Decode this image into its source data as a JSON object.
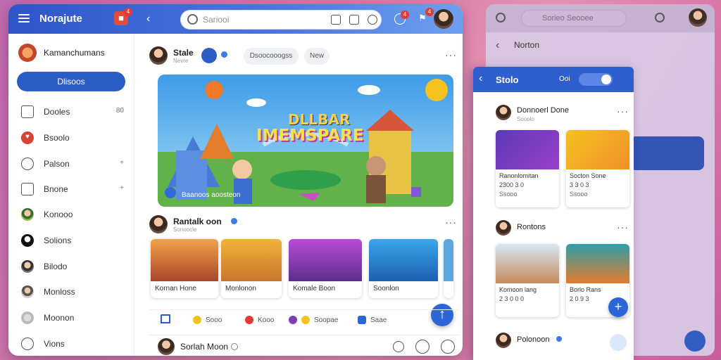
{
  "app": {
    "name": "Norajute",
    "notif_count": "4"
  },
  "search": {
    "placeholder": "Sariooi"
  },
  "header": {
    "notif_a": "4",
    "notif_b": "4"
  },
  "sidebar": {
    "profile_name": "Kamanchumans",
    "primary_button": "Dlisoos",
    "items": [
      {
        "label": "Dooles",
        "icon": "calendar-icon",
        "right": "80"
      },
      {
        "label": "Bsoolo",
        "icon": "heart-icon",
        "right": ""
      },
      {
        "label": "Palson",
        "icon": "chat-icon",
        "right": "+"
      },
      {
        "label": "Bnone",
        "icon": "file-icon",
        "right": "+"
      },
      {
        "label": "Konooo",
        "icon": "avatar",
        "right": ""
      },
      {
        "label": "Solions",
        "icon": "avatar",
        "right": ""
      },
      {
        "label": "Bilodo",
        "icon": "avatar",
        "right": ""
      },
      {
        "label": "Monloss",
        "icon": "avatar",
        "right": ""
      },
      {
        "label": "Moonon",
        "icon": "avatar",
        "right": ""
      },
      {
        "label": "Vions",
        "icon": "shield-icon",
        "right": ""
      }
    ]
  },
  "feed": {
    "post1": {
      "author": "Stale",
      "sub": "Nevre",
      "chip1": "Dsoocooogss",
      "chip2": "New"
    },
    "hero": {
      "title_top": "DLLBAR",
      "title_main": "IMEMSPARE",
      "caption": "Baanoos aoosteon"
    },
    "post2": {
      "author": "Rantalk oon",
      "sub": "Sonoocle",
      "thumbs": [
        "Kornan Hone",
        "Monlonon",
        "Komale Boon",
        "Soonlon"
      ]
    },
    "reactions": [
      "Sooo",
      "Kooo",
      "Soopae",
      "Saae"
    ],
    "post3": {
      "author": "Sorlah Moon"
    }
  },
  "phone": {
    "title": "Stolo",
    "toggle_label": "Ooi",
    "post1": {
      "author": "Donnoerl Done",
      "sub": "Sooolo"
    },
    "cards_row1": [
      {
        "title": "Ranonlomitan",
        "line2": "2300 3 0",
        "line3": "Ssooo"
      },
      {
        "title": "Socton Sone",
        "line2": "3 3 0 3",
        "line3": "Ssooo"
      }
    ],
    "post2": {
      "author": "Rontons",
      "sub": ""
    },
    "cards_row2": [
      {
        "title": "Komoon lang",
        "line2": "2 3 0 0 0",
        "line3": ""
      },
      {
        "title": "Borlo Rans",
        "line2": "2 0 9 3",
        "line3": ""
      }
    ],
    "post3": {
      "author": "Polonoon"
    }
  },
  "background_window": {
    "search_placeholder": "Sorieo Seooee",
    "title": "Norton"
  }
}
